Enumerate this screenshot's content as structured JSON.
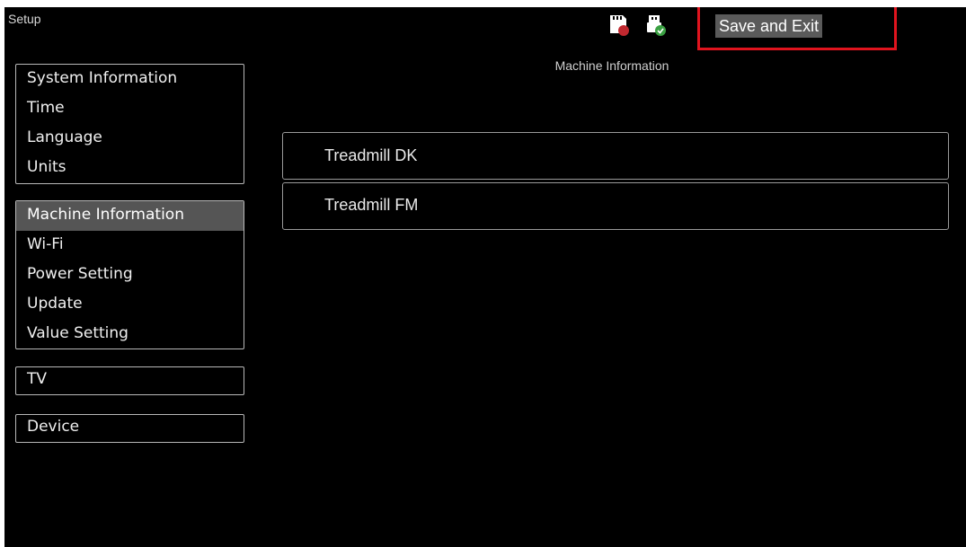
{
  "header": {
    "title": "Setup",
    "save_exit_label": "Save and Exit",
    "icons": [
      "sd-card-icon",
      "usb-icon"
    ]
  },
  "panel": {
    "title": "Machine Information"
  },
  "sidebar": {
    "group1": [
      {
        "label": "System Information"
      },
      {
        "label": "Time"
      },
      {
        "label": "Language"
      },
      {
        "label": "Units"
      }
    ],
    "group2": [
      {
        "label": "Machine Information",
        "selected": true
      },
      {
        "label": "Wi-Fi"
      },
      {
        "label": "Power Setting"
      },
      {
        "label": "Update"
      },
      {
        "label": "Value Setting"
      }
    ],
    "group3": [
      {
        "label": "TV"
      }
    ],
    "group4": [
      {
        "label": "Device"
      }
    ]
  },
  "machines": [
    {
      "label": "Treadmill DK"
    },
    {
      "label": "Treadmill FM"
    }
  ],
  "colors": {
    "background": "#000000",
    "selected": "#555555",
    "highlight": "#e0141e"
  }
}
